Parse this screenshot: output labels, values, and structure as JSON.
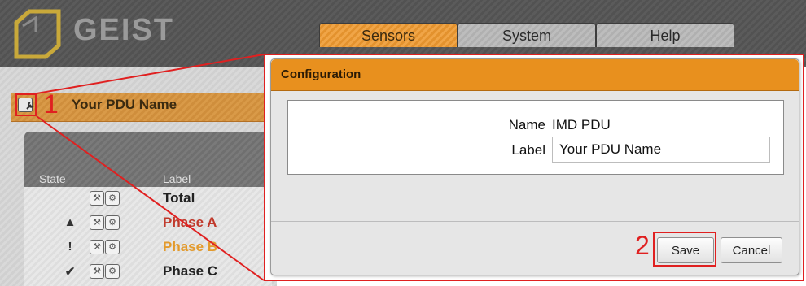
{
  "brand": {
    "logo_text": "GEIST",
    "logo_icon": "hexagon-logo-icon"
  },
  "nav": {
    "tabs": [
      {
        "label": "Sensors",
        "active": true
      },
      {
        "label": "System",
        "active": false
      },
      {
        "label": "Help",
        "active": false
      }
    ]
  },
  "device": {
    "name": "Your PDU Name",
    "config_icon": "wrench-icon"
  },
  "callouts": {
    "step1": "1",
    "step2": "2",
    "color": "#e02020"
  },
  "table": {
    "headers": {
      "state": "State",
      "label": "Label"
    },
    "rows": [
      {
        "state_icon": "",
        "label": "Total",
        "color": "#222222"
      },
      {
        "state_icon": "▲",
        "label": "Phase A",
        "color": "#c0392b"
      },
      {
        "state_icon": "!",
        "label": "Phase B",
        "color": "#e39a2c"
      },
      {
        "state_icon": "✔",
        "label": "Phase C",
        "color": "#222222"
      }
    ]
  },
  "dialog": {
    "title": "Configuration",
    "name_label": "Name",
    "name_value": "IMD PDU",
    "label_label": "Label",
    "label_value": "Your PDU Name",
    "save_label": "Save",
    "cancel_label": "Cancel"
  },
  "colors": {
    "accent": "#e8901e",
    "header_bg": "#585858"
  }
}
